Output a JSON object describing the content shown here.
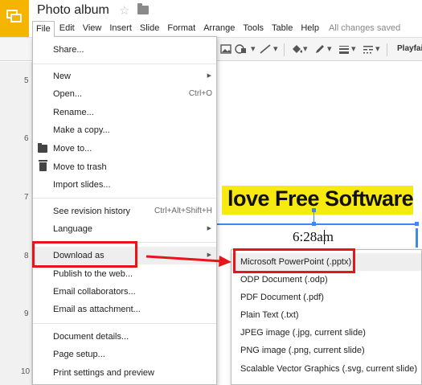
{
  "app": {
    "title": "Photo album",
    "saved_status": "All changes saved"
  },
  "menubar": [
    "File",
    "Edit",
    "View",
    "Insert",
    "Slide",
    "Format",
    "Arrange",
    "Tools",
    "Table",
    "Help"
  ],
  "toolbar": {
    "font_name": "Playfair"
  },
  "ruler": [
    "5",
    "6",
    "7",
    "8",
    "9",
    "10"
  ],
  "slide": {
    "banner_text": "love Free Software",
    "time_text": "6:28am"
  },
  "file_menu": {
    "items": [
      {
        "label": "Share..."
      },
      {
        "label": "New",
        "submenu": true
      },
      {
        "label": "Open...",
        "shortcut": "Ctrl+O"
      },
      {
        "label": "Rename..."
      },
      {
        "label": "Make a copy..."
      },
      {
        "label": "Move to...",
        "icon": "folder-icon"
      },
      {
        "label": "Move to trash",
        "icon": "trash-icon"
      },
      {
        "label": "Import slides..."
      },
      {
        "label": "See revision history",
        "shortcut": "Ctrl+Alt+Shift+H"
      },
      {
        "label": "Language",
        "submenu": true
      },
      {
        "label": "Download as",
        "submenu": true
      },
      {
        "label": "Publish to the web..."
      },
      {
        "label": "Email collaborators..."
      },
      {
        "label": "Email as attachment..."
      },
      {
        "label": "Document details..."
      },
      {
        "label": "Page setup..."
      },
      {
        "label": "Print settings and preview"
      }
    ]
  },
  "download_submenu": {
    "items": [
      "Microsoft PowerPoint (.pptx)",
      "ODP Document (.odp)",
      "PDF Document (.pdf)",
      "Plain Text (.txt)",
      "JPEG image (.jpg, current slide)",
      "PNG image (.png, current slide)",
      "Scalable Vector Graphics (.svg, current slide)"
    ]
  },
  "colors": {
    "logo": "#f4b400",
    "annotation": "#e8141b",
    "banner": "#f7ea10",
    "selection": "#4285f4"
  }
}
